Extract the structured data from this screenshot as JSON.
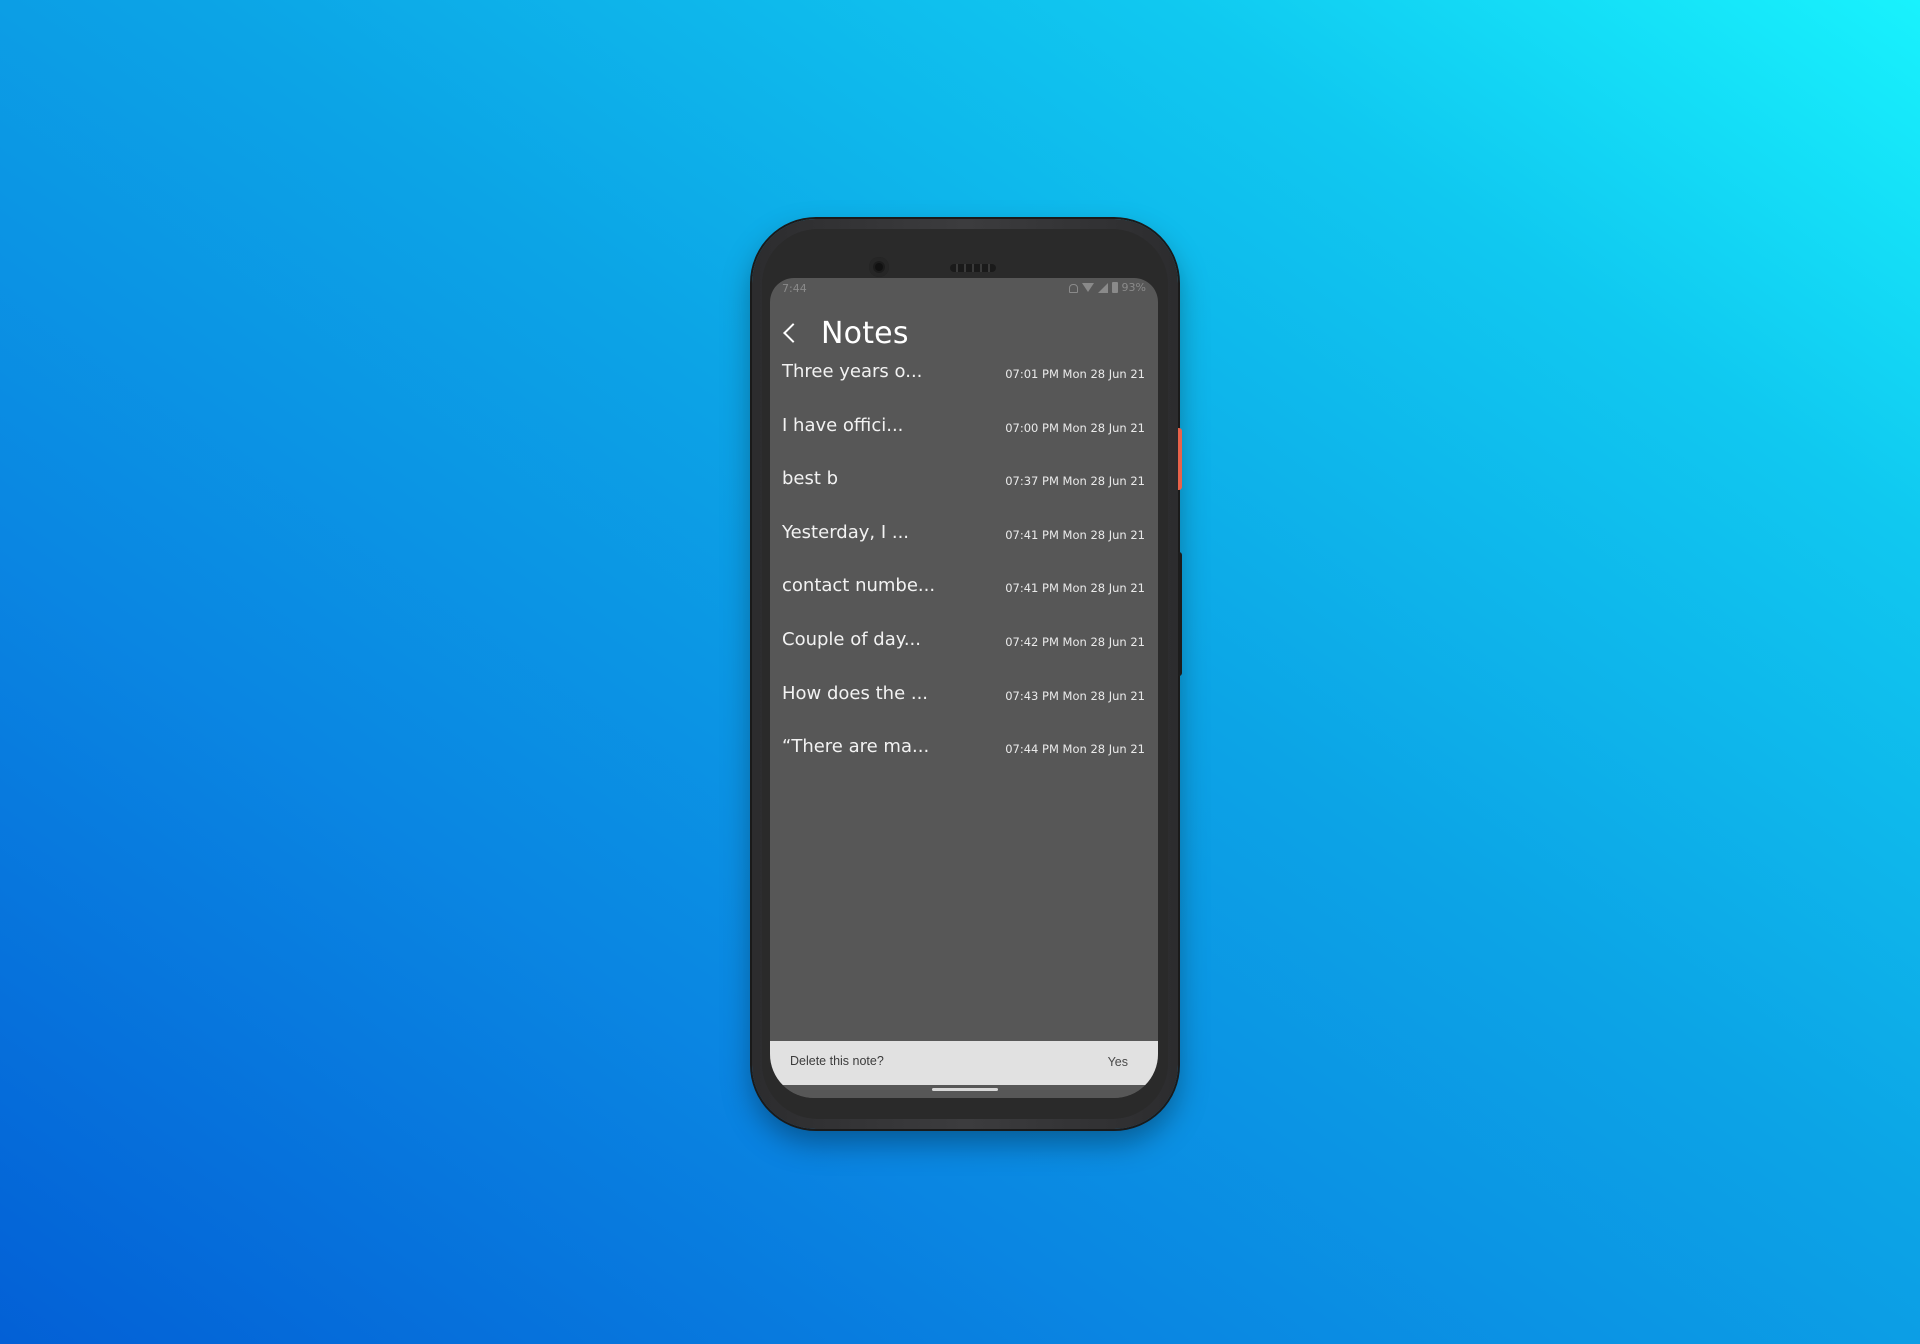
{
  "theme": {
    "background_gradient": [
      "#0360d6",
      "#18f2fd"
    ],
    "screen_bg": "#575757",
    "snackbar_bg": "#e1e1e1",
    "accent_orange": "#e8624a"
  },
  "status_bar": {
    "time": "7:44",
    "icons": [
      "bell-off-icon",
      "wifi-icon",
      "signal-icon",
      "battery-icon"
    ],
    "battery": "93%"
  },
  "header": {
    "back_icon": "chevron-left-icon",
    "title": "Notes"
  },
  "notes": [
    {
      "title": "Three years o...",
      "time": "07:01 PM Mon 28 Jun 21"
    },
    {
      "title": "I have offici...",
      "time": "07:00 PM Mon 28 Jun 21"
    },
    {
      "title": "best b",
      "time": "07:37 PM Mon 28 Jun 21"
    },
    {
      "title": "Yesterday, I ...",
      "time": "07:41 PM Mon 28 Jun 21"
    },
    {
      "title": "contact numbe...",
      "time": "07:41 PM Mon 28 Jun 21"
    },
    {
      "title": "Couple of day...",
      "time": "07:42 PM Mon 28 Jun 21"
    },
    {
      "title": "How does the ...",
      "time": "07:43 PM Mon 28 Jun 21"
    },
    {
      "title": "“There are ma...",
      "time": "07:44 PM Mon 28 Jun 21"
    }
  ],
  "snackbar": {
    "message": "Delete this note?",
    "action": "Yes"
  }
}
